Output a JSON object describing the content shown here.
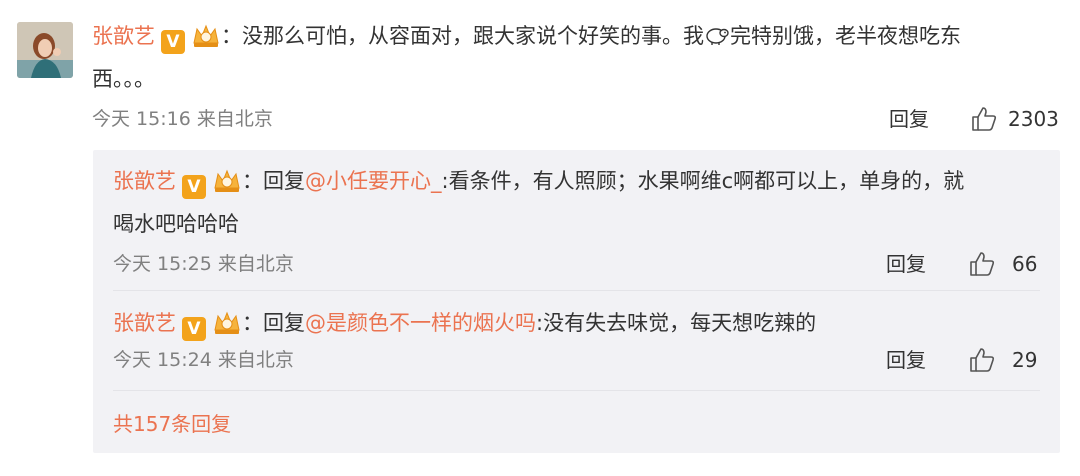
{
  "main_comment": {
    "author": "张歆艺",
    "verified_mark": "V",
    "text_line1": "：没那么可怕，从容面对，跟大家说个好笑的事。我",
    "text_line1_after": "完特别饿，老半夜想吃东",
    "text_line2": "西。。。",
    "time": "今天 15:16 来自北京",
    "reply_label": "回复",
    "likes": "2303"
  },
  "replies": [
    {
      "author": "张歆艺",
      "verified_mark": "V",
      "reply_prefix": "：回复",
      "mention": "@小任要开心_",
      "text_line1": ":看条件，有人照顾；水果啊维c啊都可以上，单身的，就",
      "text_line2": "喝水吧哈哈哈",
      "time": "今天 15:25 来自北京",
      "reply_label": "回复",
      "likes": "66"
    },
    {
      "author": "张歆艺",
      "verified_mark": "V",
      "reply_prefix": "：回复",
      "mention": "@是颜色不一样的烟火吗",
      "text_line1": ":没有失去味觉，每天想吃辣的",
      "time": "今天 15:24 来自北京",
      "reply_label": "回复",
      "likes": "29"
    }
  ],
  "more_replies": "共157条回复",
  "icons": {
    "verified": "verified-v-badge-icon",
    "member": "crown-member-icon",
    "emoji": "sheep-emoji-icon",
    "like": "thumbs-up-icon"
  },
  "colors": {
    "name": "#eb7350",
    "text": "#333333",
    "meta": "#808080",
    "reply_bg": "#f2f2f5",
    "badge": "#f3a31b"
  }
}
